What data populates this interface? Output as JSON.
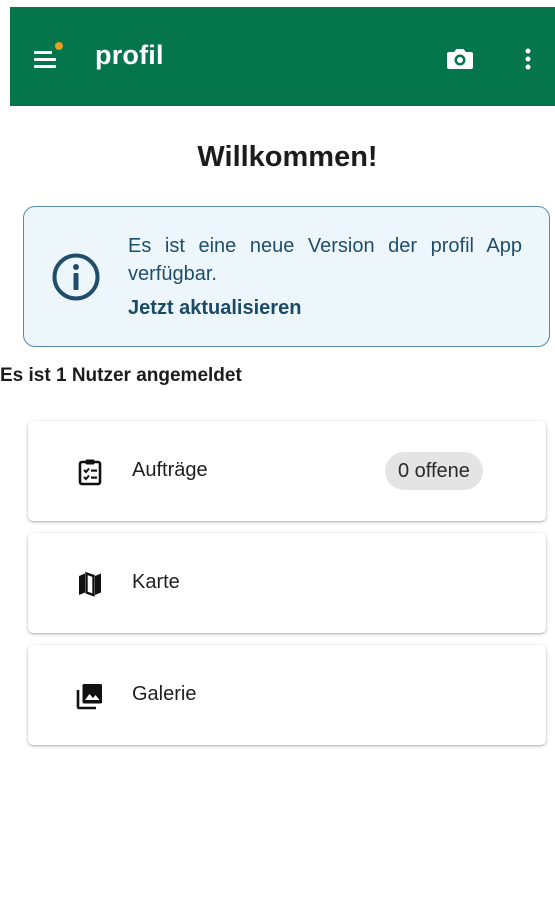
{
  "appbar": {
    "title": "profil",
    "menu_icon": "menu-icon",
    "camera_icon": "camera-icon",
    "more_icon": "more-vert-icon",
    "background_color": "#05754b",
    "notification_dot_color": "#e0a21f"
  },
  "welcome": {
    "title": "Willkommen!"
  },
  "update_banner": {
    "message": "Es ist eine neue Version der profil App verfügbar.",
    "action_label": "Jetzt aktualisieren",
    "icon": "info-icon",
    "background_color": "#edf7fb",
    "border_color": "#5a8aa5"
  },
  "users": {
    "status_text": "Es ist 1 Nutzer angemeldet"
  },
  "cards": [
    {
      "label": "Aufträge",
      "icon": "clipboard-checklist-icon",
      "badge": "0 offene"
    },
    {
      "label": "Karte",
      "icon": "map-icon"
    },
    {
      "label": "Galerie",
      "icon": "gallery-icon"
    }
  ]
}
